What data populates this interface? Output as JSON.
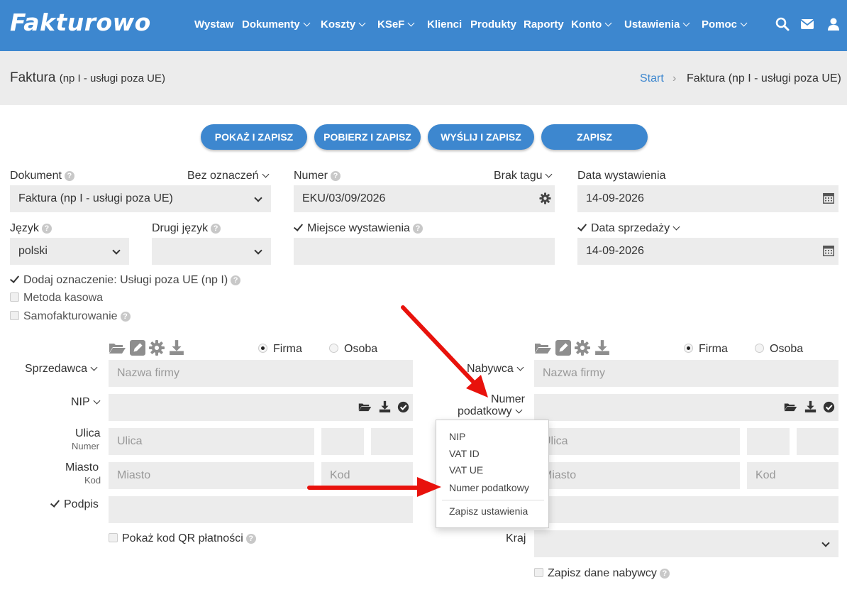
{
  "nav": {
    "logo": "Fakturowo",
    "items": [
      "Wystaw",
      "Dokumenty",
      "Koszty",
      "KSeF",
      "Klienci",
      "Produkty",
      "Raporty",
      "Konto",
      "Ustawienia",
      "Pomoc"
    ],
    "icons": [
      "search-icon",
      "envelope-icon",
      "user-icon"
    ]
  },
  "header": {
    "title": "Faktura",
    "subtitle": "(np I - usługi poza UE)",
    "breadcrumb": {
      "home": "Start",
      "current": "Faktura (np I - usługi poza UE)"
    }
  },
  "actions": {
    "show_save": "POKAŻ I ZAPISZ",
    "download_save": "POBIERZ I ZAPISZ",
    "send_save": "WYŚLIJ I ZAPISZ",
    "save": "ZAPISZ"
  },
  "form": {
    "document_label": "Dokument",
    "document_marker": "Bez oznaczeń",
    "document_value": "Faktura (np I - usługi poza UE)",
    "number_label": "Numer",
    "number_tag": "Brak tagu",
    "number_value": "EKU/03/09/2026",
    "issue_date_label": "Data wystawienia",
    "issue_date_value": "14-09-2026",
    "language_label": "Język",
    "language_value": "polski",
    "second_language_label": "Drugi język",
    "second_language_value": "",
    "place_label": "Miejsce wystawienia",
    "place_value": "",
    "sale_date_label": "Data sprzedaży",
    "sale_date_value": "14-09-2026",
    "mark_services": "Dodaj oznaczenie: Usługi poza UE (np I)",
    "cash_method": "Metoda kasowa",
    "self_invoicing": "Samofakturowanie"
  },
  "seller": {
    "label": "Sprzedawca",
    "type_company": "Firma",
    "type_person": "Osoba",
    "name_placeholder": "Nazwa firmy",
    "nip_label": "NIP",
    "street_label": "Ulica",
    "street_sub": "Numer",
    "street_placeholder": "Ulica",
    "city_label": "Miasto",
    "city_sub": "Kod",
    "city_placeholder": "Miasto",
    "code_placeholder": "Kod",
    "signature_label": "Podpis",
    "qr_label": "Pokaż kod QR płatności"
  },
  "buyer": {
    "label": "Nabywca",
    "type_company": "Firma",
    "type_person": "Osoba",
    "name_placeholder": "Nazwa firmy",
    "tax_label_1": "Numer",
    "tax_label_2": "podatkowy",
    "street_placeholder": "Ulica",
    "city_placeholder": "Miasto",
    "code_placeholder": "Kod",
    "country_label": "Kraj",
    "save_label": "Zapisz dane nabywcy"
  },
  "tax_dropdown": {
    "options": [
      "NIP",
      "VAT ID",
      "VAT UE",
      "Numer podatkowy"
    ],
    "save_settings": "Zapisz ustawienia"
  },
  "colors": {
    "brand": "#3d87cf",
    "field": "#ececec",
    "annotation": "#e8120c"
  }
}
